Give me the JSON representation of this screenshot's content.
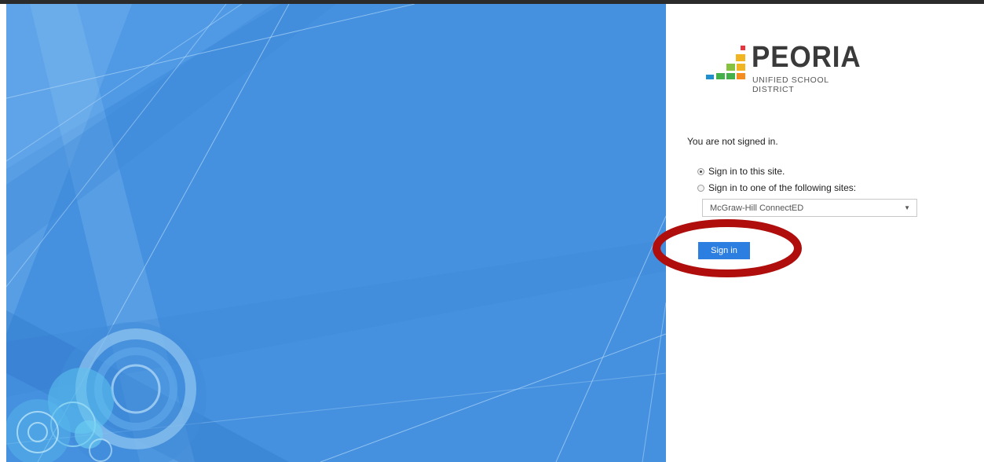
{
  "logo": {
    "title": "PEORIA",
    "subtitle": "UNIFIED SCHOOL DISTRICT"
  },
  "status": "You are not signed in.",
  "options": [
    {
      "label": "Sign in to this site.",
      "checked": true
    },
    {
      "label": "Sign in to one of the following sites:",
      "checked": false
    }
  ],
  "site_select": {
    "value": "McGraw-Hill ConnectED"
  },
  "signin_button": "Sign in",
  "colors": {
    "background_blue": "#4591df",
    "button_blue": "#2c7fe0",
    "annotation_red": "#b00d0d"
  }
}
